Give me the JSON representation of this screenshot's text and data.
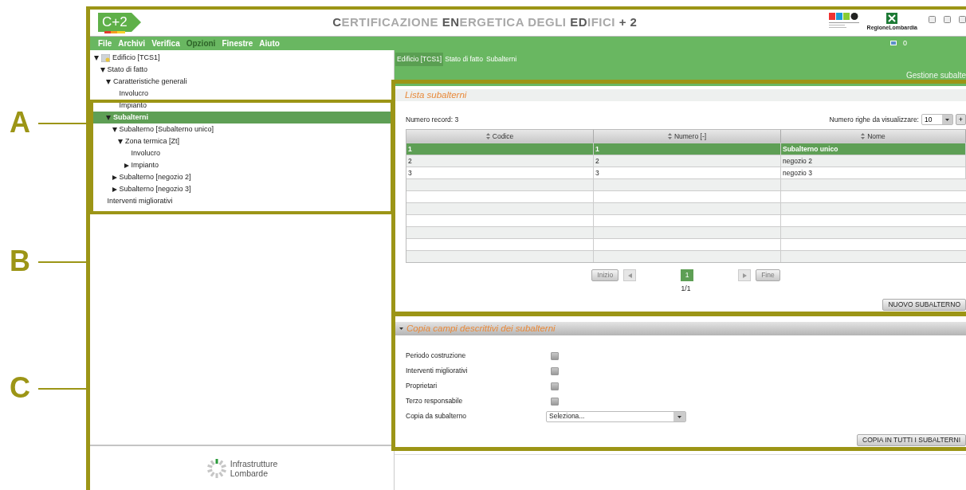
{
  "annotations": [
    {
      "label": "A"
    },
    {
      "label": "B"
    },
    {
      "label": "C"
    }
  ],
  "header": {
    "logo": "C+2",
    "title": "**C**ERTIFICAZIONE **EN**ERGETICA DEGLI **ED**IFICI **+ 2**",
    "region": "RegioneLombardia"
  },
  "menu": [
    {
      "label": "File",
      "disabled": false
    },
    {
      "label": "Archivi",
      "disabled": false
    },
    {
      "label": "Verifica",
      "disabled": false
    },
    {
      "label": "Opzioni",
      "disabled": true
    },
    {
      "label": "Finestre",
      "disabled": false
    },
    {
      "label": "Aiuto",
      "disabled": false
    }
  ],
  "messages": "0",
  "tree": [
    {
      "label": "Edificio [TCS1]",
      "expanded": true,
      "selected": false,
      "children": [
        {
          "label": "Stato di fatto",
          "expanded": true,
          "selected": false,
          "children": [
            {
              "label": "Caratteristiche generali",
              "expanded": true,
              "selected": false,
              "children": [
                {
                  "label": "Involucro",
                  "selected": false
                },
                {
                  "label": "Impianto",
                  "selected": false
                }
              ]
            },
            {
              "label": "Subalterni",
              "expanded": true,
              "selected": true,
              "children": [
                {
                  "label": "Subalterno [Subalterno unico]",
                  "expanded": true,
                  "selected": false,
                  "children": [
                    {
                      "label": "Zona termica [Zt]",
                      "expanded": true,
                      "selected": false,
                      "children": [
                        {
                          "label": "Involucro",
                          "selected": false
                        },
                        {
                          "label": "Impianto",
                          "expanded": false,
                          "selected": false
                        }
                      ]
                    }
                  ]
                },
                {
                  "label": "Subalterno [negozio 2]",
                  "expanded": false,
                  "selected": false
                },
                {
                  "label": "Subalterno [negozio 3]",
                  "expanded": false,
                  "selected": false
                }
              ]
            }
          ]
        },
        {
          "label": "Interventi migliorativi",
          "selected": false
        }
      ]
    }
  ],
  "footer": {
    "lines": [
      "Infrastrutture",
      "Lombarde"
    ]
  },
  "breadcrumb": [
    {
      "label": "Edificio [TCS1]",
      "selected": true
    },
    {
      "label": "Stato di fatto",
      "selected": false
    },
    {
      "label": "Subalterni",
      "selected": false
    }
  ],
  "page_title": "Gestione subalte",
  "list_panel": {
    "title": "Lista subalterni",
    "record_label": "Numero record:",
    "record_count": "3",
    "rows_label": "Numero righe da visualizzare:",
    "rows_value": "10",
    "add_button": "+",
    "columns": [
      "Codice",
      "Numero [-]",
      "Nome"
    ],
    "rows": [
      {
        "cells": [
          "1",
          "1",
          "Subalterno unico"
        ],
        "selected": true
      },
      {
        "cells": [
          "2",
          "2",
          "negozio 2"
        ],
        "selected": false
      },
      {
        "cells": [
          "3",
          "3",
          "negozio 3"
        ],
        "selected": false
      }
    ],
    "pagination": {
      "first": "Inizio",
      "last": "Fine",
      "pages": [
        {
          "label": "1",
          "selected": true
        }
      ],
      "info": "1/1"
    },
    "new_button": "NUOVO SUBALTERNO"
  },
  "copy_panel": {
    "title": "Copia campi descrittivi dei subalterni",
    "expanded": true,
    "fields": [
      {
        "kind": "checkbox",
        "label": "Periodo costruzione",
        "checked": false
      },
      {
        "kind": "checkbox",
        "label": "Interventi migliorativi",
        "checked": false
      },
      {
        "kind": "checkbox",
        "label": "Proprietari",
        "checked": false
      },
      {
        "kind": "checkbox",
        "label": "Terzo responsabile",
        "checked": false
      },
      {
        "kind": "select",
        "label": "Copia da subalterno",
        "value": "Seleziona..."
      }
    ],
    "button": "COPIA IN TUTTI I SUBALTERNI"
  }
}
